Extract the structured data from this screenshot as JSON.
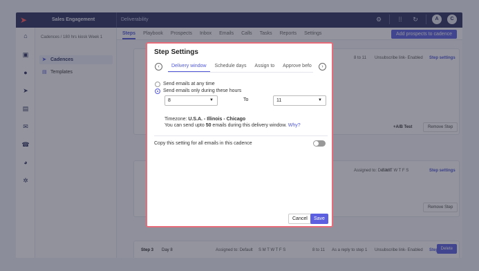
{
  "topbar": {
    "app_title": "Sales Engagement",
    "section": "Deliverability",
    "icons": [
      "logo-icon",
      "settings-icon",
      "grid-icon",
      "sync-icon"
    ],
    "avatars": [
      "A",
      "C"
    ]
  },
  "rail": {
    "icons": [
      "home-icon",
      "inbox-icon",
      "user-icon",
      "send-icon",
      "calendar-icon",
      "mail-icon",
      "phone-icon",
      "chart-icon",
      "gear-icon"
    ]
  },
  "sidepanel": {
    "breadcrumb": "Cadences / 180 hrs kiosk Week 1",
    "items": [
      {
        "label": "Cadences",
        "icon": "send-icon"
      },
      {
        "label": "Templates",
        "icon": "template-icon"
      }
    ]
  },
  "main": {
    "tabs": [
      "Steps",
      "Playbook",
      "Prospects",
      "Inbox",
      "Emails",
      "Calls",
      "Tasks",
      "Reports",
      "Settings"
    ],
    "add_button": "Add prospects to cadence",
    "step1_meta": "8 to 11",
    "step1_unsub": "Unsubscribe link- Enabled",
    "step1_settings": "Step settings",
    "ab_test": "+A/B Test",
    "remove_step": "Remove Step",
    "step2_meta": "Assigned to: Default",
    "step2_days": "S M T W T F S",
    "step2_settings": "Step settings",
    "remove_step_2": "Remove Step",
    "step3_label": "Step 3",
    "step3_day": "Day 8",
    "step3_assigned": "Assigned to: Default",
    "step3_days": "S M T W T F S",
    "step3_hours": "8 to 11",
    "step3_reply": "As a reply to step 1",
    "step3_unsub": "Unsubscribe link- Enabled",
    "step3_settings": "Step settings",
    "delete": "Delete"
  },
  "modal": {
    "title": "Step Settings",
    "tabs": [
      "Delivery window",
      "Schedule days",
      "Assign to",
      "Approve befo"
    ],
    "active_tab": "Delivery window",
    "options": [
      "Send emails at any time",
      "Send emails only during these hours"
    ],
    "selected_option": 1,
    "from_value": "8",
    "to_label": "To",
    "to_value": "11",
    "timezone_label": "Timezone: ",
    "timezone_value": "U.S.A. - Illinois - Chicago",
    "send_prefix": "You can send upto ",
    "send_count": "50",
    "send_suffix": " emails during this delivery window.",
    "why_link": "Why?",
    "copy_setting": "Copy this setting for all emails in this cadence",
    "copy_toggle_on": false,
    "cancel": "Cancel",
    "save": "Save"
  }
}
